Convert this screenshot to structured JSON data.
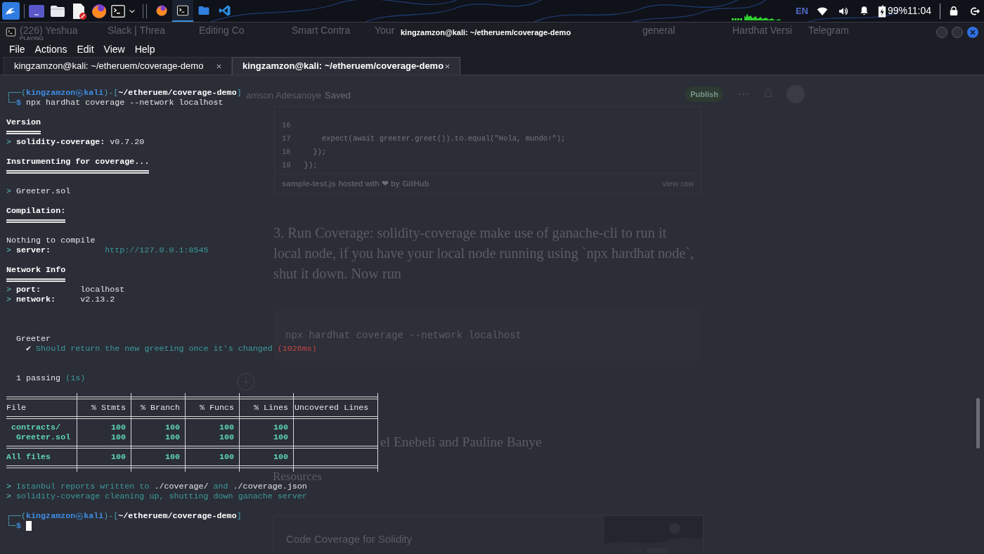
{
  "top_panel": {
    "tasks": [
      {
        "kind": "browser",
        "selected": false
      },
      {
        "kind": "terminal",
        "selected": true
      },
      {
        "kind": "files",
        "selected": false
      },
      {
        "kind": "editor",
        "selected": false
      }
    ],
    "keyboard_layout": "EN",
    "battery": "99%",
    "clock": "11:04"
  },
  "browser_tabs": [
    {
      "title": "(226) Yeshua",
      "subtitle": "PLAYING"
    },
    {
      "title": "Slack | Threa"
    },
    {
      "title": "Editing Co"
    },
    {
      "title": "Smart Contra"
    },
    {
      "title": "Your"
    },
    {
      "title": "general"
    },
    {
      "title": "Hardhat Versi"
    },
    {
      "title": "Telegram"
    }
  ],
  "browser_page": {
    "author": "amson Adesanoye",
    "save_state": "Saved",
    "publish_button": "Publish",
    "gist": {
      "lines": [
        {
          "number": "16"
        },
        {
          "number": "17",
          "code": "      expect(await greeter.greet()).to.equal(\"Hola, mundo!\");"
        },
        {
          "number": "18",
          "code": "    });"
        },
        {
          "number": "19",
          "code": "  });"
        }
      ],
      "file": "sample-test.js",
      "hosted": "hosted with ❤ by",
      "host": "GitHub",
      "view_raw": "view raw"
    },
    "paragraph": "3. Run Coverage: solidity-coverage make use of ganache-cli to run it local node, if you have your local node running using `npx hardhat node`, shut it down. Now run",
    "code_block": "npx hardhat coverage --network localhost",
    "thanks": "el Enebeli and Pauline Banye",
    "heading": "Resources",
    "card": {
      "title": "Code Coverage for Solidity",
      "kind": "picture"
    }
  },
  "terminal": {
    "title": "kingzamzon@kali: ~/etheruem/coverage-demo",
    "menu": [
      "File",
      "Actions",
      "Edit",
      "View",
      "Help"
    ],
    "tabs": [
      {
        "label": "kingzamzon@kali: ~/etheruem/coverage-demo",
        "selected": false
      },
      {
        "label": "kingzamzon@kali: ~/etheruem/coverage-demo",
        "selected": true
      }
    ],
    "lines": [
      {
        "kind": "prompt",
        "open": "┌──(",
        "user": "kingzamzon",
        "symbol": "㉿",
        "host": "kali",
        "mid": ")-[",
        "path": "~/etheruem/coverage-demo",
        "close": "]"
      },
      {
        "kind": "input",
        "corner": "└─",
        "sign": "$",
        "command": "npx hardhat coverage --network localhost"
      },
      {
        "kind": "blank"
      },
      {
        "kind": "heading",
        "text": "Version"
      },
      {
        "kind": "text",
        "segments": [
          {
            "text": ">",
            "kind": "arrow"
          },
          {
            "text": "solidity-coverage:",
            "kind": "bold"
          },
          {
            "text": "v0.7.20",
            "kind": "plain"
          }
        ]
      },
      {
        "kind": "blank"
      },
      {
        "kind": "heading",
        "text": "Instrumenting for coverage..."
      },
      {
        "kind": "blank"
      },
      {
        "kind": "text",
        "segments": [
          {
            "text": ">",
            "kind": "arrow"
          },
          {
            "text": "Greeter.sol",
            "kind": "plain"
          }
        ]
      },
      {
        "kind": "blank"
      },
      {
        "kind": "heading",
        "text": "Compilation:"
      },
      {
        "kind": "blank"
      },
      {
        "kind": "text",
        "segments": [
          {
            "text": "Nothing to compile",
            "kind": "plain"
          }
        ]
      },
      {
        "kind": "kv-wide",
        "segments": [
          {
            "text": ">",
            "kind": "arrow"
          },
          {
            "text": "server:",
            "kind": "bold"
          },
          {
            "text": "http://127.0.0.1:8545",
            "kind": "teal"
          }
        ]
      },
      {
        "kind": "blank"
      },
      {
        "kind": "heading",
        "text": "Network Info"
      },
      {
        "kind": "kv",
        "segments": [
          {
            "text": ">",
            "kind": "arrow"
          },
          {
            "text": "port:",
            "kind": "bold"
          },
          {
            "text": "localhost",
            "kind": "plain"
          }
        ]
      },
      {
        "kind": "kv",
        "segments": [
          {
            "text": ">",
            "kind": "arrow"
          },
          {
            "text": "network:",
            "kind": "bold"
          },
          {
            "text": "v2.13.2",
            "kind": "plain"
          }
        ]
      },
      {
        "kind": "blank"
      },
      {
        "kind": "blank"
      },
      {
        "kind": "blank"
      },
      {
        "kind": "suite",
        "segments": [
          {
            "text": "Greeter",
            "kind": "plain"
          }
        ]
      },
      {
        "kind": "test",
        "segments": [
          {
            "text": "✔",
            "kind": "plain"
          },
          {
            "text": "Should return the new greeting once it's changed",
            "kind": "teal"
          },
          {
            "text": "(1026ms)",
            "kind": "red"
          }
        ]
      },
      {
        "kind": "blank"
      },
      {
        "kind": "blank"
      },
      {
        "kind": "suite",
        "segments": [
          {
            "text": "1 passing",
            "kind": "plain"
          },
          {
            "text": "(1s)",
            "kind": "teal"
          }
        ]
      },
      {
        "kind": "blank"
      }
    ],
    "table": {
      "columns": [
        "File",
        "% Stmts",
        "% Branch",
        "% Funcs",
        "% Lines",
        "Uncovered Lines"
      ],
      "rows": [
        {
          "kind": "folder",
          "cells": [
            "contracts/",
            "100",
            "100",
            "100",
            "100"
          ]
        },
        {
          "kind": "file",
          "cells": [
            "Greeter.sol",
            "100",
            "100",
            "100",
            "100"
          ]
        },
        {
          "kind": "total",
          "cells": [
            "All files",
            "100",
            "100",
            "100",
            "100"
          ]
        }
      ]
    },
    "after_table": [
      {
        "kind": "blank"
      },
      {
        "kind": "text",
        "segments": [
          {
            "text": ">",
            "kind": "arrow"
          },
          {
            "text": "Istanbul reports written to",
            "kind": "teal"
          },
          {
            "text": "./coverage/",
            "kind": "plain"
          },
          {
            "text": "and",
            "kind": "teal"
          },
          {
            "text": "./coverage.json",
            "kind": "plain"
          }
        ]
      },
      {
        "kind": "text",
        "segments": [
          {
            "text": ">",
            "kind": "arrow"
          },
          {
            "text": "solidity-coverage cleaning up, shutting down ganache server",
            "kind": "teal"
          }
        ]
      },
      {
        "kind": "blank"
      },
      {
        "kind": "prompt",
        "open": "┌──(",
        "user": "kingzamzon",
        "symbol": "㉿",
        "host": "kali",
        "mid": ")-[",
        "path": "~/etheruem/coverage-demo",
        "close": "]"
      },
      {
        "kind": "input",
        "corner": "└─",
        "sign": "$",
        "cursor": true
      }
    ]
  }
}
